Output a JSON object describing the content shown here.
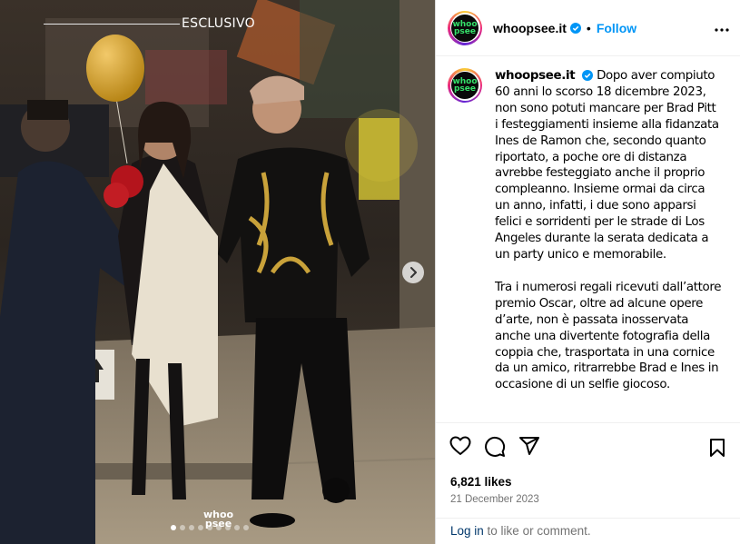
{
  "post": {
    "username": "whoopsee.it",
    "follow_label": "Follow",
    "separator": "•",
    "avatar_text": [
      "whoo",
      "psee"
    ],
    "image_overlay": "ESCLUSIVO",
    "image_watermark": [
      "whoo",
      "psee"
    ],
    "carousel": {
      "count": 9,
      "active_index": 0
    },
    "caption": [
      "Dopo aver compiuto 60 anni lo scorso 18 dicembre 2023, non sono potuti mancare per Brad Pitt i festeggiamenti insieme alla fidanzata Ines de Ramon che, secondo quanto riportato, a poche ore di distanza avrebbe festeggiato anche il proprio compleanno. Insieme ormai da circa un anno, infatti, i due sono apparsi felici e sorridenti per le strade di Los Angeles durante la serata dedicata a un party unico e memorabile.",
      "Tra i numerosi regali ricevuti dall’attore premio Oscar, oltre ad alcune opere d’arte, non è passata inosservata anche una divertente fotografia della coppia che, trasportata in una cornice da un amico, ritrarrebbe Brad e Ines in occasione di un selfie giocoso."
    ],
    "likes": "6,821 likes",
    "date": "21 December 2023",
    "login_link": "Log in",
    "login_rest": " to like or comment."
  },
  "icons": {
    "verified": "verified-badge-icon",
    "more": "more-options-icon",
    "like": "heart-icon",
    "comment": "comment-icon",
    "share": "share-icon",
    "save": "bookmark-icon",
    "next": "chevron-right-icon"
  },
  "colors": {
    "accent": "#0095f6",
    "verified": "#0095f6",
    "link": "#00376b",
    "muted": "#737373"
  }
}
